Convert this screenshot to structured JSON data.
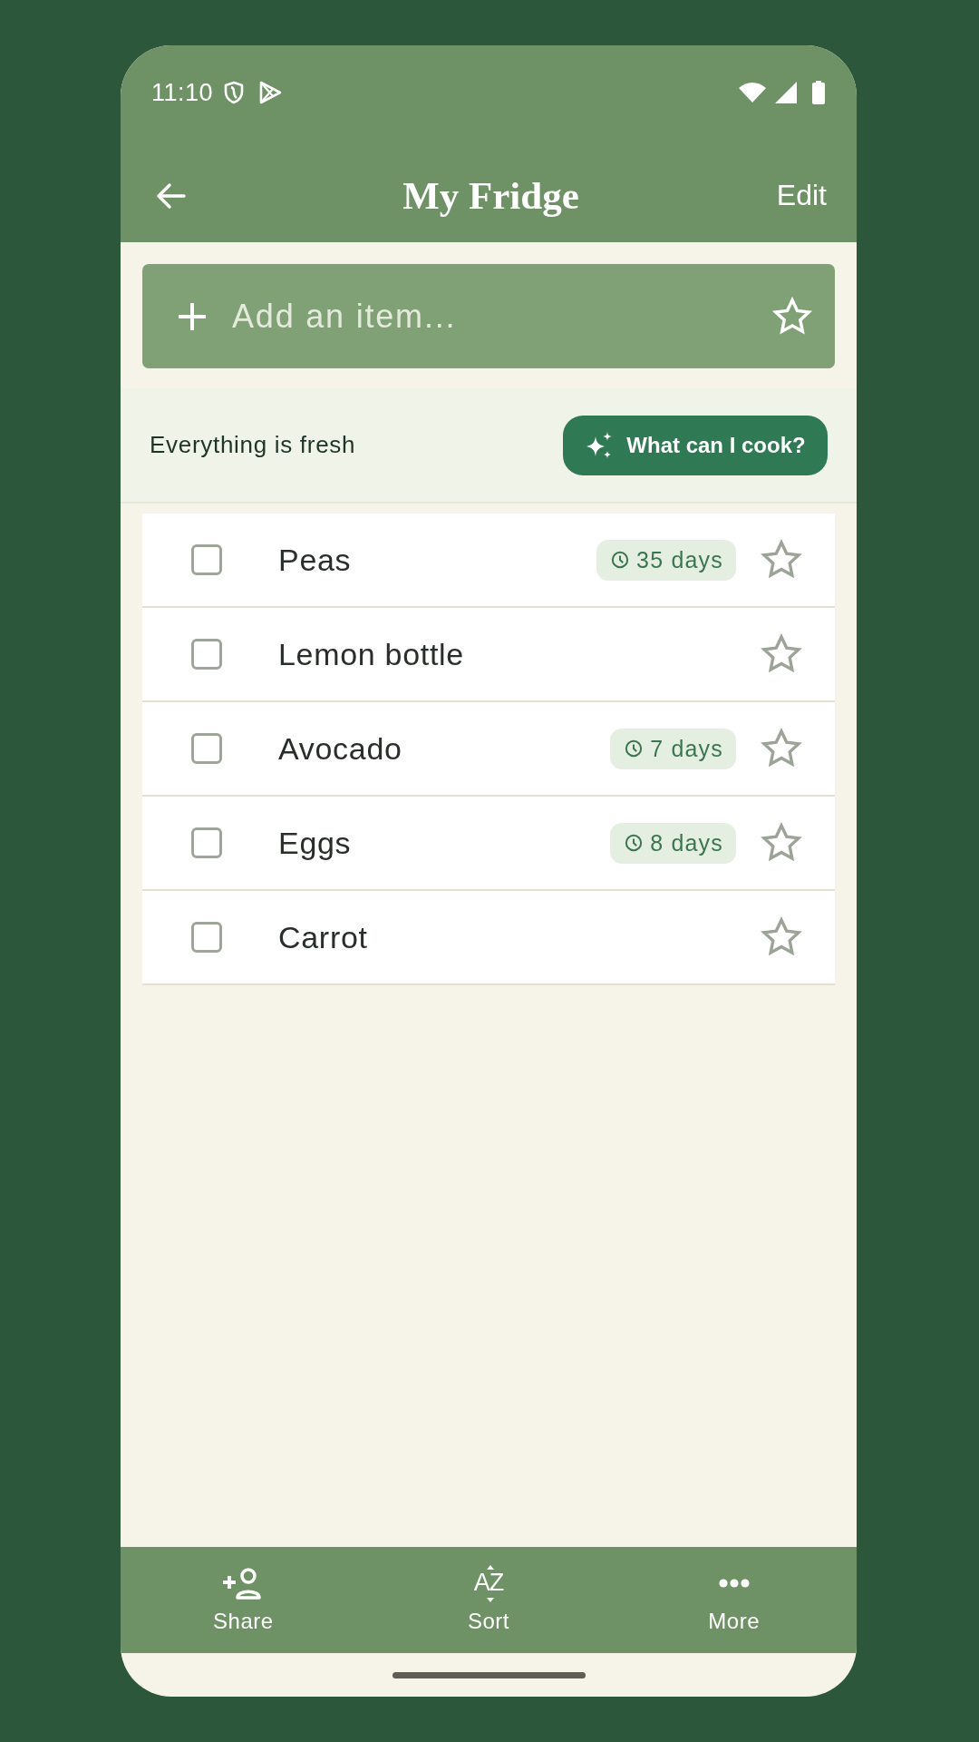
{
  "status_bar": {
    "time": "11:10"
  },
  "header": {
    "title": "My Fridge",
    "action": "Edit"
  },
  "add_item": {
    "placeholder": "Add an item..."
  },
  "summary": {
    "text": "Everything is fresh",
    "button": "What can I cook?"
  },
  "items": [
    {
      "name": "Peas",
      "checked": false,
      "starred": false,
      "expires": "35 days"
    },
    {
      "name": "Lemon bottle",
      "checked": false,
      "starred": false
    },
    {
      "name": "Avocado",
      "checked": false,
      "starred": false,
      "expires": "7 days"
    },
    {
      "name": "Eggs",
      "checked": false,
      "starred": false,
      "expires": "8 days"
    },
    {
      "name": "Carrot",
      "checked": false,
      "starred": false
    }
  ],
  "bottom_bar": [
    {
      "kind": "share",
      "label": "Share"
    },
    {
      "kind": "sort",
      "label": "Sort",
      "glyph": "AZ"
    },
    {
      "kind": "more",
      "label": "More"
    }
  ]
}
